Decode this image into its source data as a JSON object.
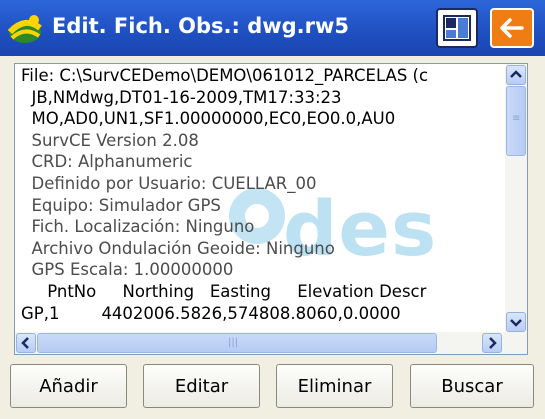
{
  "window": {
    "title": "Edit. Fich. Obs.: dwg.rw5",
    "logo_icon": "carlson-logo-icon",
    "view_icon": "view-toggle-icon",
    "back_icon": "back-arrow-icon",
    "accent_color": "#f07d14",
    "titlebar_color": "#2d66d9"
  },
  "content": {
    "lines": [
      {
        "text": "File: C:\\SurvCEDemo\\DEMO\\061012_PARCELAS (c",
        "color": "black"
      },
      {
        "text": "  JB,NMdwg,DT01-16-2009,TM17:33:23",
        "color": "black"
      },
      {
        "text": "  MO,AD0,UN1,SF1.00000000,EC0,EO0.0,AU0",
        "color": "black"
      },
      {
        "text": "  SurvCE Version 2.08",
        "color": "gray"
      },
      {
        "text": "  CRD: Alphanumeric",
        "color": "gray"
      },
      {
        "text": "  Definido por Usuario: CUELLAR_00",
        "color": "gray"
      },
      {
        "text": "  Equipo: Simulador GPS",
        "color": "gray"
      },
      {
        "text": "  Fich. Localización: Ninguno",
        "color": "gray"
      },
      {
        "text": "  Archivo Ondulación Geoide: Ninguno",
        "color": "gray"
      },
      {
        "text": "  GPS Escala: 1.00000000",
        "color": "gray"
      },
      {
        "text": "     PntNo     Northing   Easting     Elevation Descr",
        "color": "black"
      },
      {
        "text": "GP,1        4402006.5826,574808.8060,0.0000",
        "color": "black"
      }
    ],
    "watermark_text": "des"
  },
  "buttons": {
    "add": "Añadir",
    "edit": "Editar",
    "delete": "Eliminar",
    "search": "Buscar"
  }
}
